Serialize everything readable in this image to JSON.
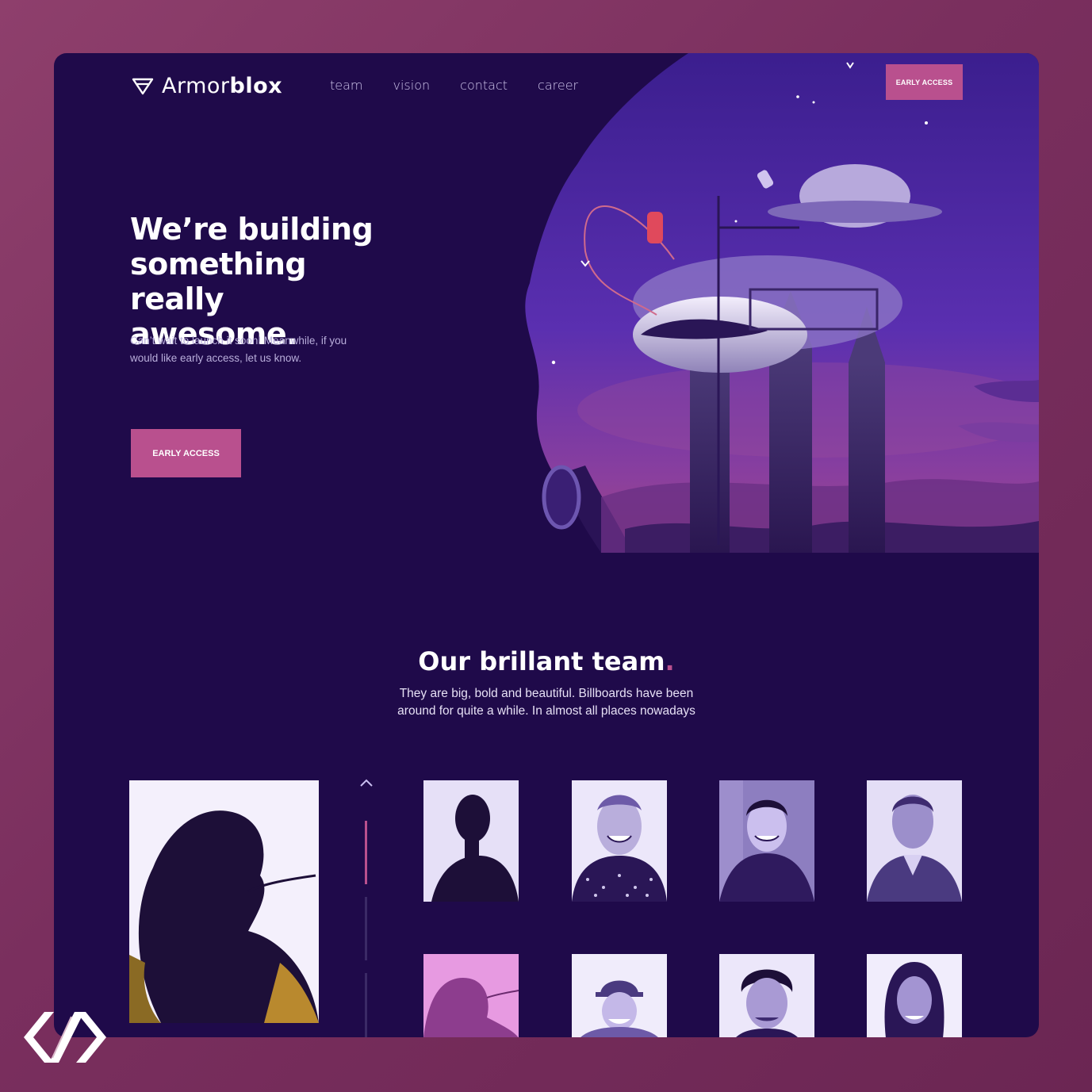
{
  "brand": {
    "name_light": "Armor",
    "name_bold": "blox"
  },
  "nav": {
    "items": [
      "team",
      "vision",
      "contact",
      "career"
    ]
  },
  "header": {
    "cta_label": "EARLY ACCESS"
  },
  "hero": {
    "title": "We’re building something really awesome.",
    "subtitle": "Can’t wait to launch it soon! Meanwhile, if you would like early access, let us know.",
    "cta_label": "EARLY ACCESS"
  },
  "team": {
    "title": "Our brillant team",
    "title_dot": ".",
    "subtitle": "They are big, bold and beautiful. Billboards have been around for quite a while. In almost all places nowadays"
  },
  "icons": {
    "logo": "shield-logo-icon",
    "scroll_up": "chevron-up-icon",
    "watermark": "angle-brackets-logo-icon"
  },
  "colors": {
    "background": "#1f0a4a",
    "accent": "#b9508e",
    "page_backdrop": "#8e3f6c"
  }
}
